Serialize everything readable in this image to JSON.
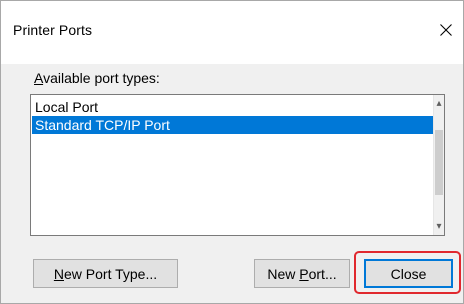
{
  "window": {
    "title": "Printer Ports",
    "close_icon": "close-icon"
  },
  "ports": {
    "label_mnemonic": "A",
    "label_rest": "vailable port types:",
    "items": [
      {
        "label": "Local Port",
        "selected": false
      },
      {
        "label": "Standard TCP/IP Port",
        "selected": true
      }
    ]
  },
  "buttons": {
    "new_port_type": {
      "mnemonic": "N",
      "rest": "ew Port Type..."
    },
    "new_port": {
      "before": "New ",
      "mnemonic": "P",
      "after": "ort..."
    },
    "close": {
      "label": "Close"
    }
  },
  "colors": {
    "selection": "#0078d7",
    "highlight_ring": "#e0282e",
    "dialog_bg": "#f0f0f0"
  }
}
